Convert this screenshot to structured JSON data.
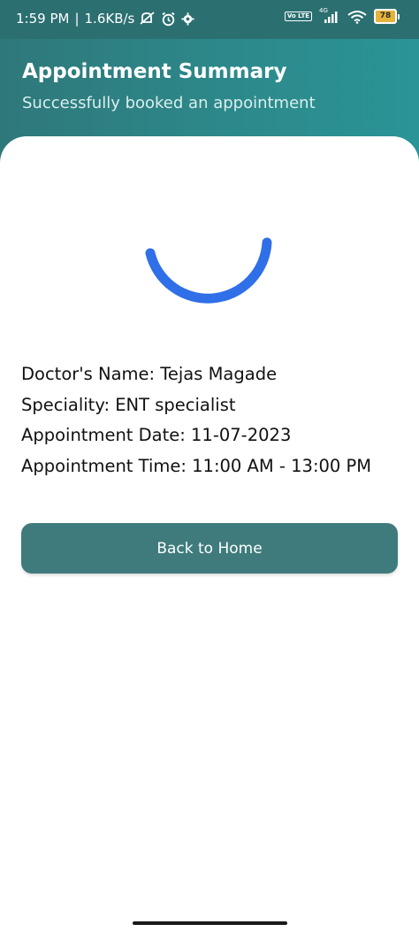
{
  "status_bar": {
    "time": "1:59 PM",
    "separator": "|",
    "speed": "1.6KB/s",
    "network": "4G",
    "volte": "Vo LTE",
    "battery": "78"
  },
  "header": {
    "title": "Appointment Summary",
    "subtitle": "Successfully booked an appointment"
  },
  "details": {
    "doctor": "Doctor's Name: Tejas Magade",
    "speciality": "Speciality: ENT specialist",
    "date": "Appointment Date: 11-07-2023",
    "time": "Appointment Time: 11:00 AM - 13:00 PM"
  },
  "actions": {
    "back_home": "Back to Home"
  },
  "colors": {
    "header": "#2f787a",
    "spinner": "#2f6fe8",
    "button": "#3f7b7c"
  }
}
